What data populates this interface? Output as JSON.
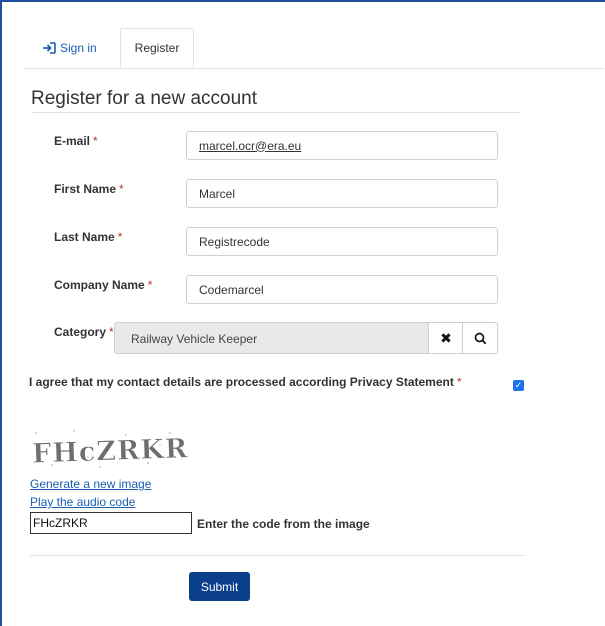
{
  "tabs": [
    {
      "label": "Sign in",
      "icon": "sign-in-icon"
    },
    {
      "label": "Register"
    }
  ],
  "form": {
    "title": "Register for a new account",
    "required_marker": "*",
    "email": {
      "label": "E-mail",
      "value": "marcel.ocr@era.eu"
    },
    "first_name": {
      "label": "First Name",
      "value": "Marcel"
    },
    "last_name": {
      "label": "Last Name",
      "value": "Registrecode"
    },
    "company_name": {
      "label": "Company Name",
      "value": "Codemarcel"
    },
    "category": {
      "label": "Category",
      "value": "Railway Vehicle Keeper",
      "clear_icon": "close-icon",
      "search_icon": "search-icon"
    },
    "agree": {
      "label": "I agree that my contact details are processed according Privacy Statement",
      "checked": true
    }
  },
  "captcha": {
    "image_text": "FHcZRKR",
    "generate_link": "Generate a new image",
    "audio_link": "Play the audio code",
    "code_value": "FHcZRKR",
    "code_label": "Enter the code from the image"
  },
  "submit_label": "Submit",
  "colors": {
    "accent": "#1a5fb4",
    "submit": "#0b3f8c",
    "required": "#c0392b",
    "checkbox": "#1a73e8"
  }
}
